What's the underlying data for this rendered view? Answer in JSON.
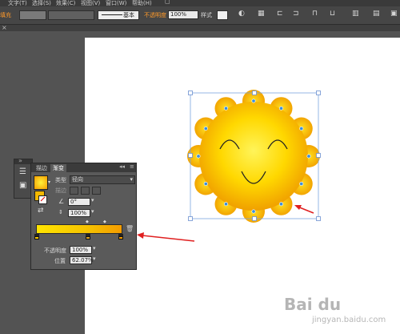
{
  "menu": {
    "items": [
      "文字(T)",
      "选择(S)",
      "效果(C)",
      "视图(V)",
      "窗口(W)",
      "帮助(H)"
    ]
  },
  "control_bar": {
    "fill_label": "填充",
    "stroke_style_label": "基本",
    "opacity_label": "不透明度",
    "opacity_value": "100%",
    "style_label": "样式"
  },
  "gradient_panel": {
    "tabs": [
      "描边",
      "渐变"
    ],
    "type_label": "类型",
    "type_value": "径向",
    "stroke_label": "描边",
    "angle_value": "0°",
    "aspect_value": "100%",
    "opacity_label": "不透明度",
    "opacity_value": "100%",
    "location_label": "位置",
    "location_value": "62.07%",
    "stops": [
      {
        "position": 0,
        "color": "#f5c400"
      },
      {
        "position": 50,
        "color": "#d9a020"
      },
      {
        "position": 100,
        "color": "#f39c00"
      }
    ],
    "colors": {
      "start": "#ffe400",
      "end": "#f39c00"
    }
  },
  "artwork": {
    "face_colors": {
      "center": "#ffee4d",
      "edge": "#f0a000",
      "petal_outer": "#f2a400",
      "dot": "#3d8fd8"
    }
  },
  "annotations": {
    "arrow_color": "#e02020"
  },
  "watermark": {
    "text": "Bai du",
    "sub": "jingyan.baidu.com"
  }
}
